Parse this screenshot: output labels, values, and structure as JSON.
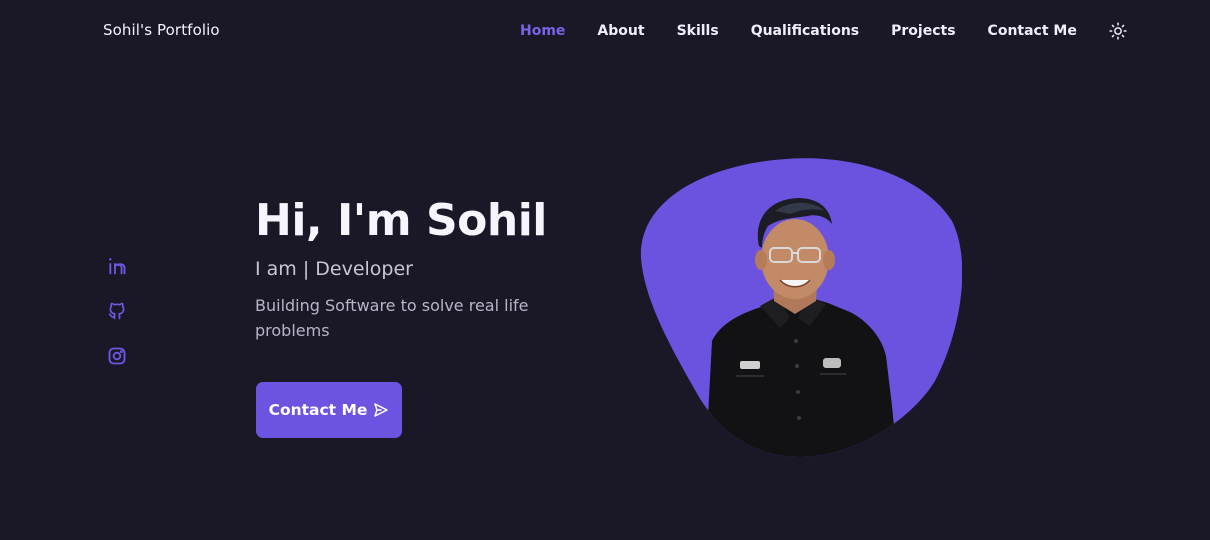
{
  "header": {
    "logo": "Sohil's Portfolio",
    "nav": [
      {
        "label": "Home",
        "active": true
      },
      {
        "label": "About"
      },
      {
        "label": "Skills"
      },
      {
        "label": "Qualifications"
      },
      {
        "label": "Projects"
      },
      {
        "label": "Contact Me"
      }
    ],
    "theme_toggle_icon": "sun-icon"
  },
  "socials": [
    {
      "icon": "linkedin-icon"
    },
    {
      "icon": "github-icon"
    },
    {
      "icon": "instagram-icon"
    }
  ],
  "hero": {
    "title": "Hi, I'm Sohil",
    "subtitle": "I am | Developer",
    "description": "Building Software to solve real life problems",
    "button_label": "Contact Me",
    "button_icon": "send-icon"
  },
  "colors": {
    "background": "#1a1727",
    "accent": "#6d54e0",
    "nav_active": "#7b63e6",
    "text": "#f1eef9",
    "muted_text": "#b9b5c8"
  }
}
